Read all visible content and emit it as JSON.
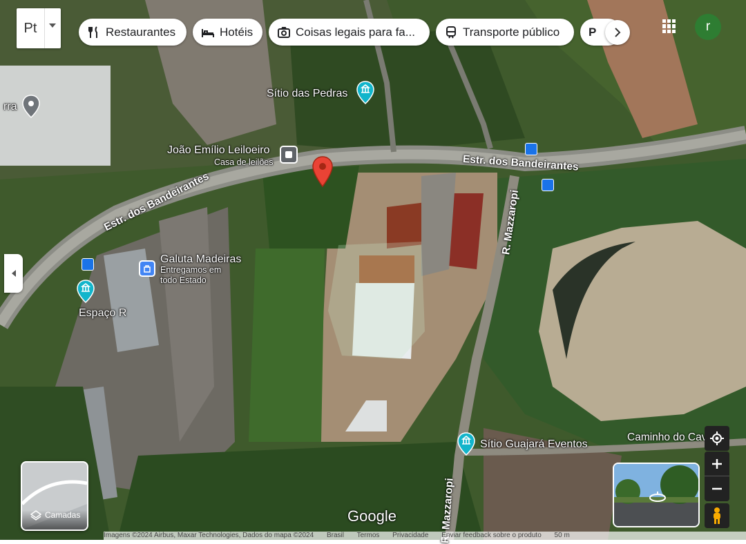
{
  "search": {
    "logo_text": "Pt"
  },
  "chips": [
    {
      "label": "Restaurantes",
      "icon": "fork-knife-icon"
    },
    {
      "label": "Hotéis",
      "icon": "bed-icon"
    },
    {
      "label": "Coisas legais para fa...",
      "icon": "camera-icon"
    },
    {
      "label": "Transporte público",
      "icon": "train-icon"
    },
    {
      "label": "P",
      "icon": ""
    }
  ],
  "account": {
    "initial": "r",
    "color": "#2e7d32"
  },
  "places": [
    {
      "name": "Sítio das Pedras"
    },
    {
      "name": "João Emílio Leiloeiro",
      "subtitle": "Casa de leilões"
    },
    {
      "name": "Galuta Madeiras",
      "subtitle1": "Entregamos em",
      "subtitle2": "todo Estado"
    },
    {
      "name": "Espaço R"
    },
    {
      "name": "Sítio Guajará Eventos"
    },
    {
      "name": "rra"
    }
  ],
  "roads": {
    "bandeirantes_1": "Estr. dos Bandeirantes",
    "bandeirantes_2": "Estr. dos Bandeirantes",
    "mazzaropi_1": "R. Mazzaropi",
    "mazzaropi_2": "R. Mazzaropi",
    "caminho": "Caminho do Cavalo"
  },
  "layers": {
    "label": "Camadas"
  },
  "brand": "Google",
  "footer": {
    "imagery": "Imagens ©2024 Airbus, Maxar Technologies, Dados do mapa ©2024",
    "country": "Brasil",
    "terms": "Termos",
    "privacy": "Privacidade",
    "feedback": "Enviar feedback sobre o produto",
    "scale": "50 m"
  },
  "colors": {
    "pin_red": "#ea4335",
    "accent_blue": "#1a73e8",
    "teal": "#12b5cb"
  }
}
